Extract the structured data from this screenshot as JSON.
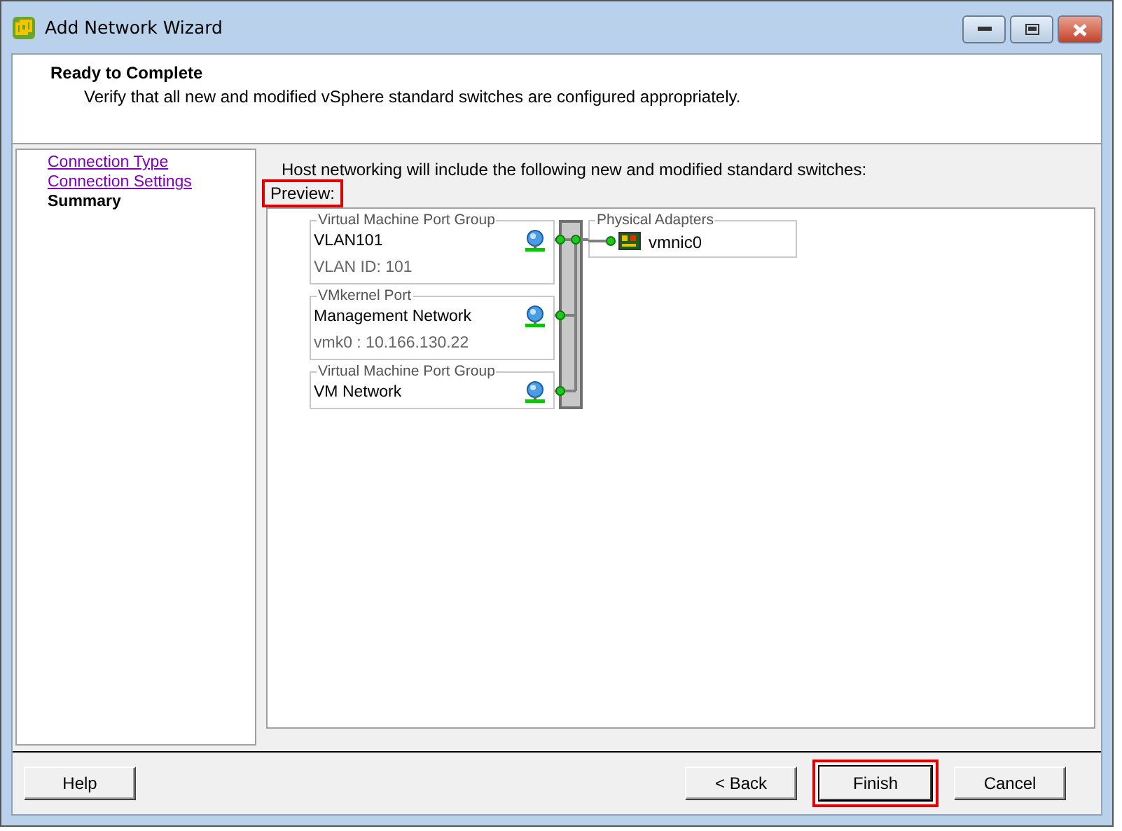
{
  "window": {
    "title": "Add Network Wizard"
  },
  "header": {
    "title": "Ready to Complete",
    "subtitle": "Verify that all new and modified vSphere standard switches are configured appropriately."
  },
  "steps": [
    {
      "label": "Connection Type",
      "selected": false
    },
    {
      "label": "Connection Settings",
      "selected": false
    },
    {
      "label": "Summary",
      "selected": true
    }
  ],
  "intro": "Host networking will include the following new and modified standard switches:",
  "preview": {
    "label": "Preview:",
    "highlighted": true
  },
  "port_groups": [
    {
      "kind": "Virtual Machine Port Group",
      "name": "VLAN101",
      "detail": "VLAN ID: 101"
    },
    {
      "kind": "VMkernel Port",
      "name": "Management Network",
      "detail": "vmk0 : 10.166.130.22"
    },
    {
      "kind": "Virtual Machine Port Group",
      "name": "VM Network"
    }
  ],
  "physical_adapters": {
    "label": "Physical Adapters",
    "adapters": [
      "vmnic0"
    ]
  },
  "buttons": [
    {
      "label": "Help",
      "highlighted": false
    },
    {
      "label": "< Back",
      "highlighted": false
    },
    {
      "label": "Finish",
      "highlighted": true
    },
    {
      "label": "Cancel",
      "highlighted": false
    }
  ]
}
